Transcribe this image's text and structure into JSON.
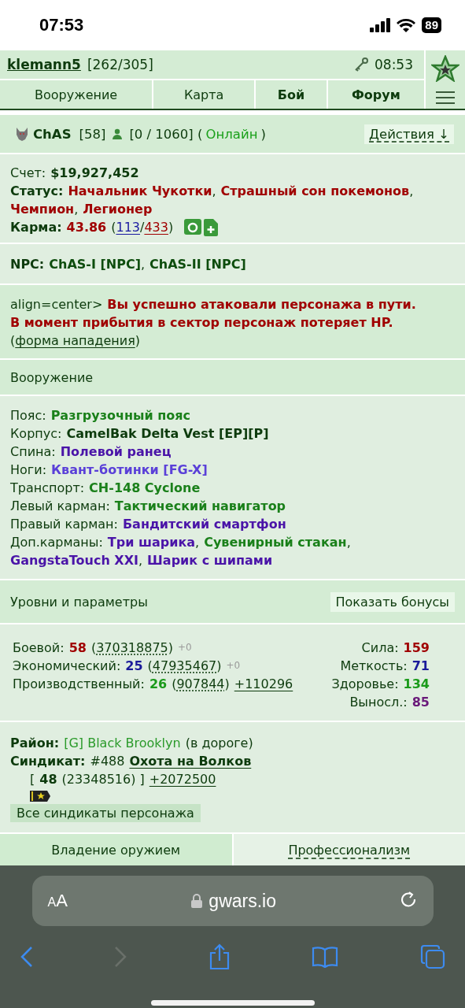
{
  "phone_status": {
    "time": "07:53",
    "battery": "89"
  },
  "header": {
    "user": "klemann5",
    "hp": "[262/305]",
    "clock": "08:53"
  },
  "nav_tabs": [
    {
      "label": "Вооружение",
      "kind": "plain"
    },
    {
      "label": "Карта",
      "kind": "plain"
    },
    {
      "label": "Бой",
      "kind": "strong"
    },
    {
      "label": "Форум",
      "kind": "strong"
    }
  ],
  "character": {
    "name_parts": [
      {
        "text": "ChAS",
        "kind": "name"
      },
      {
        "text": "[58]",
        "kind": "text"
      }
    ],
    "status_parts": [
      {
        "text": "[0 / 1060] (",
        "kind": "text"
      },
      {
        "text": "Онлайн",
        "kind": "online"
      },
      {
        "text": ")",
        "kind": "text"
      }
    ],
    "actions": "Действия ↓"
  },
  "info": [
    {
      "kind": "plain",
      "parts": [
        {
          "text": "Счет:",
          "kind": "label"
        },
        {
          "text": "$19,927,452",
          "kind": "money"
        }
      ]
    },
    {
      "kind": "plain",
      "parts": [
        {
          "text": "Статус:",
          "kind": "label-bold"
        },
        {
          "text": "Начальник Чукотки",
          "kind": "title"
        },
        {
          "text": ",",
          "kind": "text"
        },
        {
          "text": "Страшный сон покемонов",
          "kind": "title"
        },
        {
          "text": ",",
          "kind": "text"
        }
      ]
    },
    {
      "kind": "plain",
      "parts": [
        {
          "text": "Чемпион",
          "kind": "title"
        },
        {
          "text": ",",
          "kind": "text"
        },
        {
          "text": "Легионер",
          "kind": "title"
        }
      ]
    },
    {
      "kind": "karma",
      "parts": [
        {
          "text": "Карма:",
          "kind": "label-bold"
        },
        {
          "text": "43.86",
          "kind": "value-red"
        },
        {
          "text": "(",
          "kind": "text"
        },
        {
          "text": "113",
          "kind": "link-blue"
        },
        {
          "text": "/",
          "kind": "text"
        },
        {
          "text": "433",
          "kind": "link-red"
        },
        {
          "text": ")",
          "kind": "text"
        }
      ]
    }
  ],
  "npc": [
    {
      "kind": "plain",
      "parts": [
        {
          "text": "NPC:",
          "kind": "label-bold"
        },
        {
          "text": "ChAS-I [NPC]",
          "kind": "npc"
        },
        {
          "text": ",",
          "kind": "text"
        },
        {
          "text": "ChAS-II [NPC]",
          "kind": "npc"
        }
      ]
    }
  ],
  "message": [
    {
      "kind": "plain",
      "parts": [
        {
          "text": "align=center>",
          "kind": "text"
        },
        {
          "text": "Вы успешно атаковали персонажа в пути.",
          "kind": "alert"
        }
      ]
    },
    {
      "kind": "plain",
      "parts": [
        {
          "text": "В момент прибытия в сектор персонаж потеряет HP.",
          "kind": "alert"
        }
      ]
    },
    {
      "kind": "plain",
      "parts": [
        {
          "text": "(",
          "kind": "text"
        },
        {
          "text": "форма нападения",
          "kind": "link"
        },
        {
          "text": ")",
          "kind": "text"
        }
      ]
    }
  ],
  "equipment_title": "Вооружение",
  "equipment": [
    {
      "kind": "plain",
      "parts": [
        {
          "text": "Пояс:",
          "kind": "label"
        },
        {
          "text": "Разгрузочный пояс",
          "kind": "item-green"
        }
      ]
    },
    {
      "kind": "plain",
      "parts": [
        {
          "text": "Корпус:",
          "kind": "label"
        },
        {
          "text": "CamelBak Delta Vest [EP][P]",
          "kind": "item-dark"
        }
      ]
    },
    {
      "kind": "plain",
      "parts": [
        {
          "text": "Спина:",
          "kind": "label"
        },
        {
          "text": "Полевой ранец",
          "kind": "item-purple"
        }
      ]
    },
    {
      "kind": "plain",
      "parts": [
        {
          "text": "Ноги:",
          "kind": "label"
        },
        {
          "text": "Квант-ботинки [FG-X]",
          "kind": "item-violet"
        }
      ]
    },
    {
      "kind": "plain",
      "parts": [
        {
          "text": "Транспорт:",
          "kind": "label"
        },
        {
          "text": "CH-148 Cyclone",
          "kind": "item-green"
        }
      ]
    },
    {
      "kind": "plain",
      "parts": [
        {
          "text": "Левый карман:",
          "kind": "label"
        },
        {
          "text": "Тактический навигатор",
          "kind": "item-green"
        }
      ]
    },
    {
      "kind": "plain",
      "parts": [
        {
          "text": "Правый карман:",
          "kind": "label"
        },
        {
          "text": "Бандитский смартфон",
          "kind": "item-purple"
        }
      ]
    },
    {
      "kind": "plain",
      "parts": [
        {
          "text": "Доп.карманы:",
          "kind": "label"
        },
        {
          "text": "Три шарика",
          "kind": "item-purple"
        },
        {
          "text": ",",
          "kind": "text"
        },
        {
          "text": "Сувенирный стакан",
          "kind": "item-green"
        },
        {
          "text": ",",
          "kind": "text"
        }
      ]
    },
    {
      "kind": "plain",
      "parts": [
        {
          "text": "GangstaTouch XXI",
          "kind": "item-purple"
        },
        {
          "text": ",",
          "kind": "text"
        },
        {
          "text": "Шарик с шипами",
          "kind": "item-purple"
        }
      ]
    }
  ],
  "levels_title": "Уровни и параметры",
  "bonus_button": "Показать бонусы",
  "stats": {
    "left": [
      {
        "kind": "plain",
        "parts": [
          {
            "text": "Боевой:",
            "kind": "label"
          },
          {
            "text": "58",
            "kind": "value-red"
          },
          {
            "text": "(",
            "kind": "text"
          },
          {
            "text": "370318875",
            "kind": "dotted"
          },
          {
            "text": ")",
            "kind": "text"
          },
          {
            "text": "+0",
            "kind": "muted"
          }
        ]
      },
      {
        "kind": "plain",
        "parts": [
          {
            "text": "Экономический:",
            "kind": "label"
          },
          {
            "text": "25",
            "kind": "value-blue"
          },
          {
            "text": "(",
            "kind": "text"
          },
          {
            "text": "47935467",
            "kind": "dotted"
          },
          {
            "text": ")",
            "kind": "text"
          },
          {
            "text": "+0",
            "kind": "muted"
          }
        ]
      },
      {
        "kind": "plain",
        "parts": [
          {
            "text": "Производственный:",
            "kind": "label"
          },
          {
            "text": "26",
            "kind": "value-green"
          },
          {
            "text": "(",
            "kind": "text"
          },
          {
            "text": "907844",
            "kind": "dotted"
          },
          {
            "text": ")",
            "kind": "text"
          },
          {
            "text": "+110296",
            "kind": "link"
          }
        ]
      }
    ],
    "right": [
      {
        "kind": "plain",
        "parts": [
          {
            "text": "Сила:",
            "kind": "label"
          },
          {
            "text": "159",
            "kind": "value-red"
          }
        ]
      },
      {
        "kind": "plain",
        "parts": [
          {
            "text": "Меткость:",
            "kind": "label"
          },
          {
            "text": "71",
            "kind": "value-blue"
          }
        ]
      },
      {
        "kind": "plain",
        "parts": [
          {
            "text": "Здоровье:",
            "kind": "label"
          },
          {
            "text": "134",
            "kind": "value-green"
          }
        ]
      },
      {
        "kind": "plain",
        "parts": [
          {
            "text": "Выносл.:",
            "kind": "label"
          },
          {
            "text": "85",
            "kind": "value-purple"
          }
        ]
      }
    ]
  },
  "district": [
    {
      "kind": "plain",
      "parts": [
        {
          "text": "Район:",
          "kind": "label-bold"
        },
        {
          "text": "[G] Black Brooklyn",
          "kind": "district"
        },
        {
          "text": "(в дороге)",
          "kind": "text"
        }
      ]
    },
    {
      "kind": "plain",
      "parts": [
        {
          "text": "Синдикат:",
          "kind": "label-bold"
        },
        {
          "text": "#488",
          "kind": "text"
        },
        {
          "text": "Охота на Волков",
          "kind": "link-bold"
        }
      ]
    },
    {
      "kind": "indent",
      "parts": [
        {
          "text": "[",
          "kind": "text"
        },
        {
          "text": "48",
          "kind": "money"
        },
        {
          "text": "(23348516) ]",
          "kind": "text"
        },
        {
          "text": "+2072500",
          "kind": "link"
        }
      ]
    }
  ],
  "syndicates_button": "Все синдикаты персонажа",
  "bottom_tabs": [
    {
      "label": "Владение оружием",
      "selected": true
    },
    {
      "label": "Профессионализм",
      "selected": false
    }
  ],
  "browser": {
    "text_size": "AA",
    "url": "gwars.io"
  }
}
